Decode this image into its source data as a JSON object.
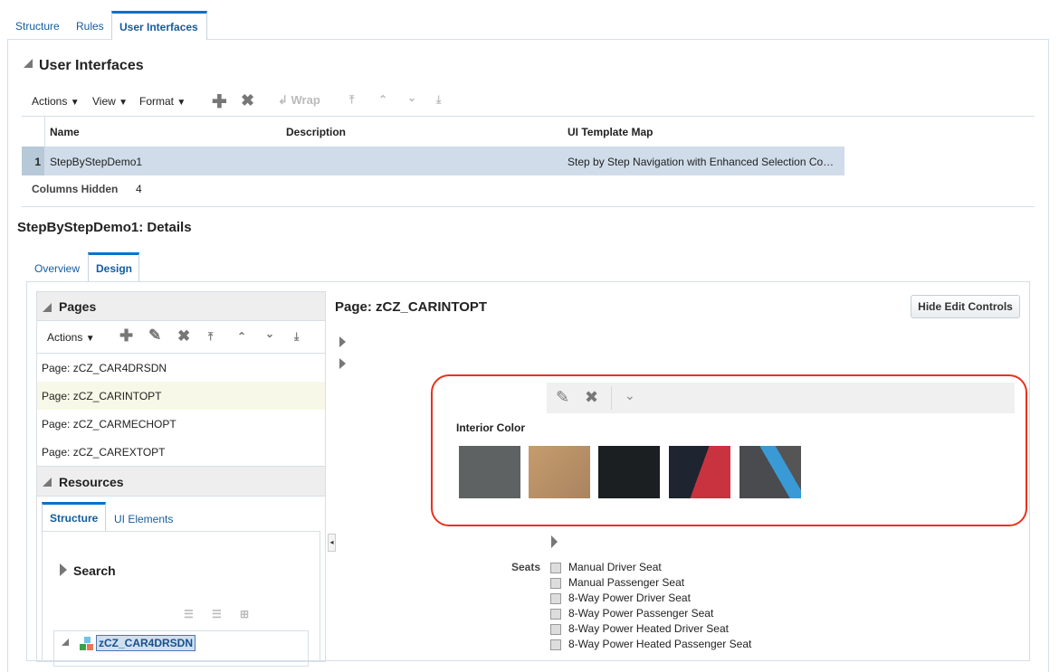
{
  "tabs": [
    "Structure",
    "Rules",
    "User Interfaces"
  ],
  "section_title": "User Interfaces",
  "toolbar": {
    "actions": "Actions",
    "view": "View",
    "format": "Format",
    "wrap": "Wrap"
  },
  "table": {
    "columns": [
      "Name",
      "Description",
      "UI Template Map"
    ],
    "rows": [
      {
        "num": "1",
        "name": "StepByStepDemo1",
        "description": "",
        "template": "Step by Step Navigation with Enhanced Selection Co…"
      }
    ],
    "columns_hidden_label": "Columns Hidden",
    "columns_hidden_value": "4"
  },
  "details_title": "StepByStepDemo1: Details",
  "detail_tabs": [
    "Overview",
    "Design"
  ],
  "pages": {
    "title": "Pages",
    "actions": "Actions",
    "items": [
      "Page: zCZ_CAR4DRSDN",
      "Page: zCZ_CARINTOPT",
      "Page: zCZ_CARMECHOPT",
      "Page: zCZ_CAREXTOPT"
    ]
  },
  "resources": {
    "title": "Resources",
    "tabs": [
      "Structure",
      "UI Elements"
    ],
    "search": "Search",
    "tree_root": "zCZ_CAR4DRSDN"
  },
  "page_title": "Page: zCZ_CARINTOPT",
  "hide_button": "Hide Edit Controls",
  "interior": {
    "label": "Interior Color",
    "swatches": [
      "#5f6262",
      "#b89166",
      "#1c1f22",
      "#c8333f",
      "#3a9ad6"
    ]
  },
  "seats": {
    "label": "Seats",
    "options": [
      "Manual Driver Seat",
      "Manual Passenger Seat",
      "8-Way Power Driver Seat",
      "8-Way Power Passenger Seat",
      "8-Way Power Heated Driver Seat",
      "8-Way Power Heated Passenger Seat"
    ]
  },
  "highlight_color": "#e8321e"
}
